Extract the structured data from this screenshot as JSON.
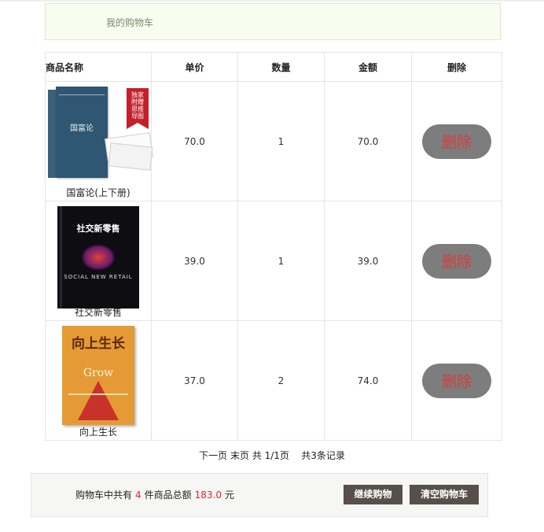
{
  "header": {
    "title": "我的购物车"
  },
  "table": {
    "columns": [
      "商品名称",
      "单价",
      "数量",
      "金额",
      "删除"
    ],
    "rows": [
      {
        "name": "国富论(上下册)",
        "cover_title": "国富论",
        "ribbon": "独家附赠 思维导图",
        "price": "70.0",
        "qty": "1",
        "amount": "70.0",
        "delete": "删除"
      },
      {
        "name": "社交新零售",
        "cover_title": "社交新零售",
        "cover_en": "SOCIAL NEW RETAIL",
        "price": "39.0",
        "qty": "1",
        "amount": "39.0",
        "delete": "删除"
      },
      {
        "name": "向上生长",
        "cover_title": "向上生长",
        "cover_en": "Grow",
        "price": "37.0",
        "qty": "2",
        "amount": "74.0",
        "delete": "删除"
      }
    ]
  },
  "pager": {
    "next": "下一页",
    "last": "末页",
    "page_info": "共 1/1页",
    "records": "共3条记录"
  },
  "summary": {
    "prefix": "购物车中共有",
    "count": "4",
    "middle": "件商品总额",
    "total": "183.0",
    "unit": "元",
    "continue_label": "继续购物",
    "clear_label": "清空购物车"
  },
  "colors": {
    "accent_red": "#e2262a",
    "button_dark": "#57504a",
    "delete_bg": "#7d7d7d"
  }
}
